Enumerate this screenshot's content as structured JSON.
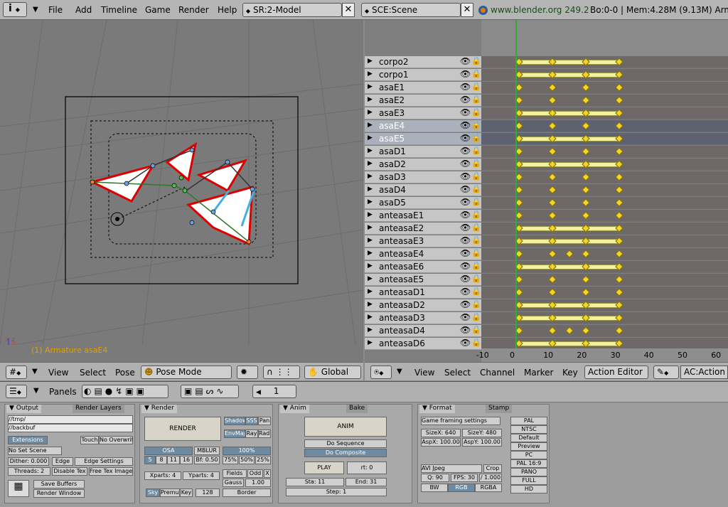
{
  "topbar": {
    "menus": [
      "File",
      "Add",
      "Timeline",
      "Game",
      "Render",
      "Help"
    ],
    "screen": "SR:2-Model",
    "scene": "SCE:Scene",
    "url": "www.blender.org 249.2",
    "stats": "Bo:0-0 | Mem:4.28M (9.13M) Arm"
  },
  "viewport": {
    "status": "(1) Armature asaE4",
    "header": {
      "menus": [
        "View",
        "Select",
        "Pose"
      ],
      "mode": "Pose Mode",
      "orientation": "Global"
    }
  },
  "action_editor": {
    "channels": [
      "corpo2",
      "corpo1",
      "asaE1",
      "asaE2",
      "asaE3",
      "asaE4",
      "asaE5",
      "asaD1",
      "asaD2",
      "asaD3",
      "asaD4",
      "asaD5",
      "anteasaE1",
      "anteasaE2",
      "anteasaE3",
      "anteasaE4",
      "anteasaE6",
      "anteasaE5",
      "anteasaD1",
      "anteasaD2",
      "anteasaD3",
      "anteasaD4",
      "anteasaD6"
    ],
    "ticks": [
      "-10",
      "0",
      "10",
      "20",
      "30",
      "40",
      "50",
      "60"
    ],
    "header": {
      "menus": [
        "View",
        "Select",
        "Channel",
        "Marker",
        "Key"
      ],
      "editor": "Action Editor",
      "action": "AC:Action"
    }
  },
  "buttons_window": {
    "panels_label": "Panels",
    "frame": "1",
    "output": {
      "tabs": [
        "Output",
        "Render Layers"
      ],
      "path1": "//tmp/",
      "path2": "//backbuf",
      "extensions": "Extensions",
      "touch": "Touch",
      "no_overwrite": "No Overwrite",
      "no_set_scene": "No Set Scene",
      "dither": "Dither: 0.000",
      "edge": "Edge",
      "edge_settings": "Edge Settings",
      "threads": "Threads: 2",
      "disable_tex": "Disable Tex",
      "free_tex": "Free Tex Image",
      "save_buffers": "Save Buffers",
      "render_window": "Render Window"
    },
    "render": {
      "tab": "Render",
      "render_btn": "RENDER",
      "shadow": "Shadow",
      "sss": "SSS",
      "pano": "Pan",
      "envmap": "EnvMap",
      "ray": "Ray",
      "radio": "Radi",
      "osa": "OSA",
      "mblur": "MBLUR",
      "pct": "100%",
      "osa_vals": [
        "5",
        "8",
        "11",
        "16"
      ],
      "bf": "Bf: 0.50",
      "pcts": [
        "75%",
        "50%",
        "25%"
      ],
      "xparts": "Xparts: 4",
      "yparts": "Yparts: 4",
      "fields": "Fields",
      "odd": "Odd",
      "x": "X",
      "gauss": "Gauss",
      "gauss_val": "1.00",
      "sky": "Sky",
      "premul": "Premul",
      "key": "Key",
      "bits": "128",
      "border": "Border"
    },
    "anim": {
      "tabs": [
        "Anim",
        "Bake"
      ],
      "anim_btn": "ANIM",
      "do_sequence": "Do Sequence",
      "do_composite": "Do Composite",
      "play": "PLAY",
      "rt": "rt: 0",
      "sta": "Sta: 11",
      "end": "End: 31",
      "step": "Step: 1"
    },
    "format": {
      "tabs": [
        "Format",
        "Stamp"
      ],
      "game_framing": "Game framing settings",
      "sizex": "SizeX: 640",
      "sizey": "SizeY: 480",
      "aspx": "AspX: 100.00",
      "aspy": "AspY: 100.00",
      "codec": "AVI Jpeg",
      "crop": "Crop",
      "quality": "Q: 90",
      "fps": "FPS: 30",
      "fpsdiv": "/ 1.000",
      "bw": "BW",
      "rgb": "RGB",
      "rgba": "RGBA",
      "presets": [
        "PAL",
        "NTSC",
        "Default",
        "Preview",
        "PC",
        "PAL 16:9",
        "PANO",
        "FULL",
        "HD"
      ]
    }
  }
}
